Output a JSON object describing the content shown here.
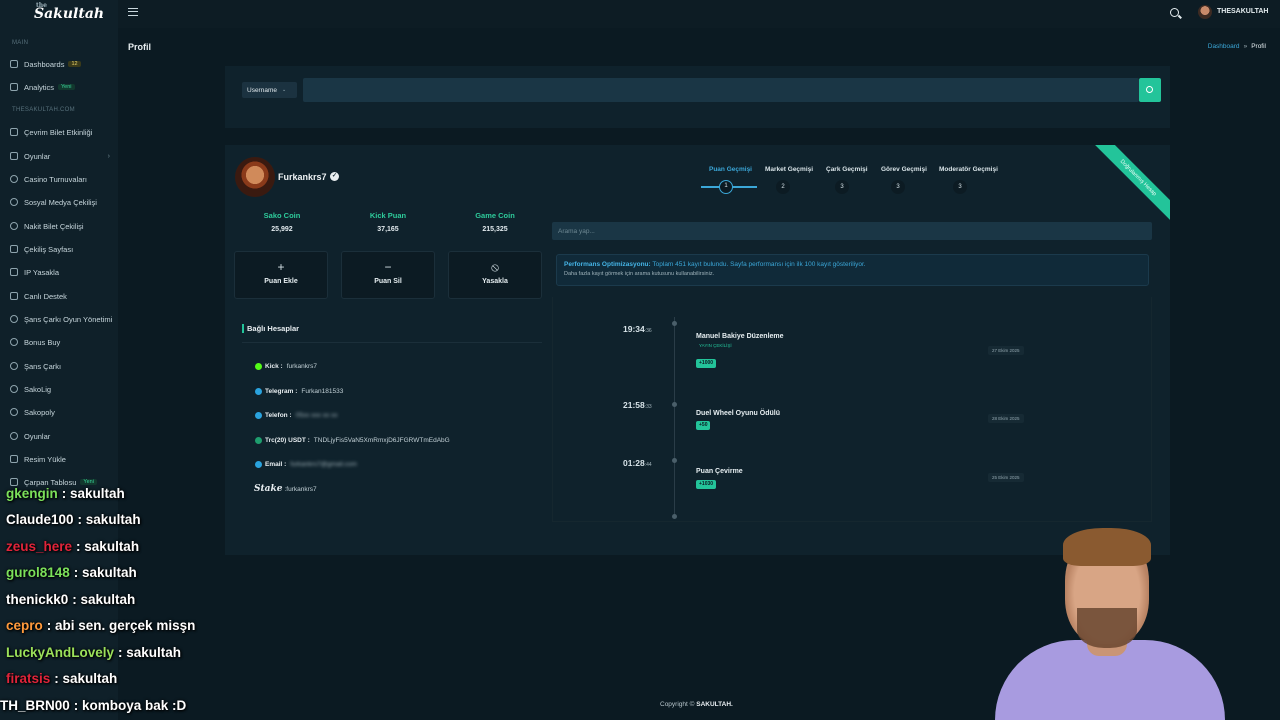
{
  "app": {
    "logo_small": "the",
    "logo": "Sakultah"
  },
  "topbar": {
    "username": "THESAKULTAH"
  },
  "sidebar": {
    "section_main": "MAIN",
    "section_site": "THESAKULTAH.COM",
    "items": [
      {
        "label": "Dashboards",
        "badge": "12"
      },
      {
        "label": "Analytics",
        "badge": "Yeni"
      },
      {
        "label": "Çevrim Bilet Etkinliği"
      },
      {
        "label": "Oyunlar"
      },
      {
        "label": "Casino Turnuvaları"
      },
      {
        "label": "Sosyal Medya Çekilişi"
      },
      {
        "label": "Nakit Bilet Çekilişi"
      },
      {
        "label": "Çekiliş Sayfası"
      },
      {
        "label": "IP Yasakla"
      },
      {
        "label": "Canlı Destek"
      },
      {
        "label": "Şans Çarkı Oyun Yönetimi"
      },
      {
        "label": "Bonus Buy"
      },
      {
        "label": "Şans Çarkı"
      },
      {
        "label": "SakoLig"
      },
      {
        "label": "Sakopoly"
      },
      {
        "label": "Oyunlar"
      },
      {
        "label": "Resim Yükle"
      },
      {
        "label": "Çarpan Tablosu",
        "badge": "Yeni"
      }
    ]
  },
  "page": {
    "title": "Profil",
    "breadcrumb_link": "Dashboard",
    "breadcrumb_sep": "»",
    "breadcrumb_current": "Profil"
  },
  "search": {
    "select_value": "Username",
    "input_value": ""
  },
  "profile": {
    "name": "Furkankrs7",
    "ribbon": "Doğrulanmış Hesap",
    "stats": [
      {
        "label": "Sako Coin",
        "value": "25,992"
      },
      {
        "label": "Kick Puan",
        "value": "37,165"
      },
      {
        "label": "Game Coin",
        "value": "215,325"
      }
    ],
    "actions": [
      {
        "icon": "plus-icon",
        "symbol": "+",
        "label": "Puan Ekle"
      },
      {
        "icon": "minus-icon",
        "symbol": "−",
        "label": "Puan Sil"
      },
      {
        "icon": "ban-icon",
        "symbol": "⦸",
        "label": "Yasakla"
      }
    ],
    "linked_title": "Bağlı Hesaplar",
    "linked": [
      {
        "label": "Kick :",
        "value": "furkankrs7",
        "color": "#53fc18"
      },
      {
        "label": "Telegram :",
        "value": "Furkan181533",
        "color": "#2aa3de"
      },
      {
        "label": "Telefon :",
        "value": "05xx xxx xx xx",
        "color": "#2aa3de"
      },
      {
        "label": "Trc(20) USDT :",
        "value": "TNDLjyFis5VaN5XmRmxjD6JFGRWTmEdAbG",
        "color": "#1e9e6e"
      },
      {
        "label": "Email :",
        "value": "furkankrs7@gmail.com",
        "color": "#2aa3de"
      },
      {
        "label": "Stake",
        "value": "furkankrs7"
      }
    ]
  },
  "history": {
    "tabs": [
      {
        "label": "Puan Geçmişi",
        "step": "1"
      },
      {
        "label": "Market Geçmişi",
        "step": "2"
      },
      {
        "label": "Çark Geçmişi",
        "step": "3"
      },
      {
        "label": "Görev Geçmişi",
        "step": "3"
      },
      {
        "label": "Moderatör Geçmişi",
        "step": "3"
      }
    ],
    "search_placeholder": "Arama yap...",
    "info_title": "Performans Optimizasyonu:",
    "info_text": "Toplam 451 kayıt bulundu. Sayfa performansı için ilk 100 kayıt gösteriliyor.",
    "info_sub": "Daha fazla kayıt görmek için arama kutusunu kullanabilirsiniz.",
    "entries": [
      {
        "time": "19:34",
        "sec": ":36",
        "title": "Manuel Bakiye Düzenleme",
        "sub": "YAYIN ÇEKİLİŞİ",
        "pill": "+1000",
        "date": "27 Ekim 2025"
      },
      {
        "time": "21:58",
        "sec": ":33",
        "title": "Duel Wheel Oyunu Ödülü",
        "sub": "",
        "pill": "+50",
        "date": "28 Ekim 2025"
      },
      {
        "time": "01:28",
        "sec": ":44",
        "title": "Puan Çevirme",
        "sub": "",
        "pill": "+1030",
        "date": "25 Ekim 2025"
      }
    ]
  },
  "footer": {
    "copyright_prefix": "Copyright ©",
    "copyright_brand": "SAKULTAH."
  },
  "chat": [
    {
      "user": "gkengin",
      "msg": ": sakultah",
      "color": "#7be05a"
    },
    {
      "user": "Claude100",
      "msg": ": sakultah",
      "color": "#ffffff"
    },
    {
      "user": "zeus_here",
      "msg": ": sakultah",
      "color": "#e0243a"
    },
    {
      "user": "gurol8148",
      "msg": ": sakultah",
      "color": "#7be05a"
    },
    {
      "user": "thenickk0",
      "msg": ": sakultah",
      "color": "#ffffff"
    },
    {
      "user": "cepro",
      "msg": ": abi sen. gerçek misşn",
      "color": "#ff9a3c"
    },
    {
      "user": "LuckyAndLovely",
      "msg": ": sakultah",
      "color": "#9be05a"
    },
    {
      "user": "firatsis",
      "msg": ": sakultah",
      "color": "#e0243a"
    },
    {
      "user": "TH_BRN00",
      "msg": ": komboya bak :D",
      "color": "#ffffff"
    }
  ]
}
